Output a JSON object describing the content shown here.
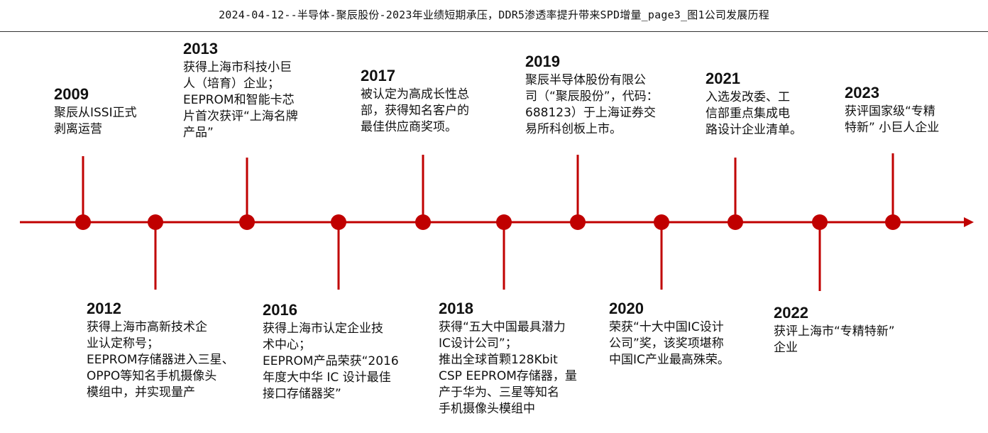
{
  "header": {
    "title": "2024-04-12--半导体-聚辰股份-2023年业绩短期承压，DDR5渗透率提升带来SPD增量_page3_图1公司发展历程"
  },
  "colors": {
    "accent": "#c00000",
    "text": "#111111"
  },
  "events": [
    {
      "year": "2009",
      "desc": "聚辰从ISSI正式\n剥离运营"
    },
    {
      "year": "2012",
      "desc": "获得上海市高新技术企\n业认定称号；\nEEPROM存储器进入三星、\nOPPO等知名手机摄像头\n模组中，并实现量产"
    },
    {
      "year": "2013",
      "desc": "获得上海市科技小巨\n人（培育）企业；\nEEPROM和智能卡芯\n片首次获评“上海名牌\n产品”"
    },
    {
      "year": "2016",
      "desc": "获得上海市认定企业技\n术中心；\nEEPROM产品荣获“2016\n年度大中华 IC 设计最佳\n接口存储器奖”"
    },
    {
      "year": "2017",
      "desc": "被认定为高成长性总\n部，获得知名客户的\n最佳供应商奖项。"
    },
    {
      "year": "2018",
      "desc": "获得“五大中国最具潜力\nIC设计公司”；\n推出全球首颗128Kbit\nCSP EEPROM存储器，量\n产于华为、三星等知名\n手机摄像头模组中"
    },
    {
      "year": "2019",
      "desc": "聚辰半导体股份有限公\n司（“聚辰股份”，代码：\n688123）于上海证券交\n易所科创板上市。"
    },
    {
      "year": "2020",
      "desc": "荣获“十大中国IC设计\n公司”奖，该奖项堪称\n中国IC产业最高殊荣。"
    },
    {
      "year": "2021",
      "desc": "入选发改委、工\n信部重点集成电\n路设计企业清单。"
    },
    {
      "year": "2022",
      "desc": "获评上海市“专精特新”\n企业"
    },
    {
      "year": "2023",
      "desc": "获评国家级“专精\n特新” 小巨人企业"
    }
  ]
}
